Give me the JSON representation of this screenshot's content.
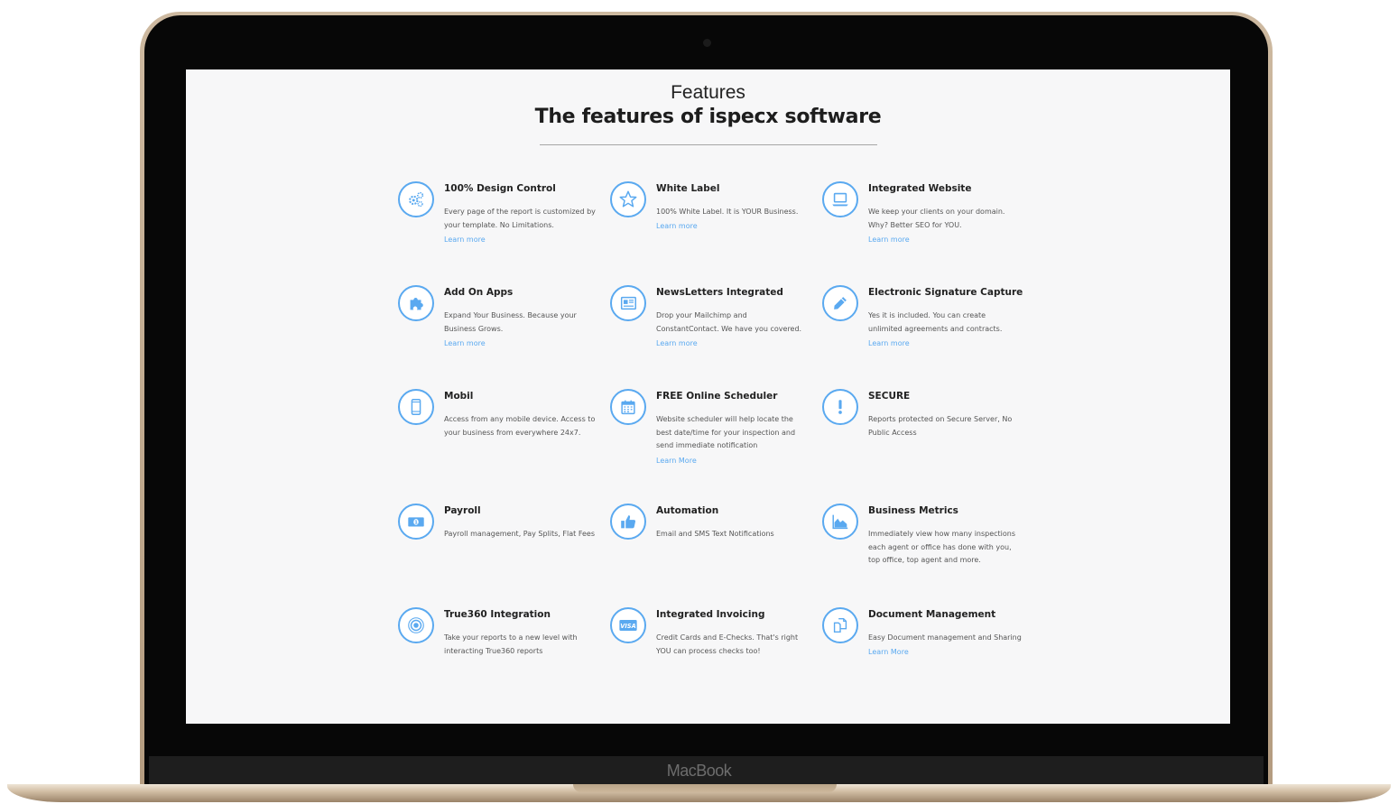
{
  "device": {
    "brand_label": "MacBook"
  },
  "section": {
    "kicker": "Features",
    "headline": "The features of ispecx software"
  },
  "colors": {
    "accent": "#5aa9f0",
    "background": "#f7f7f8",
    "text": "#222222"
  },
  "features": [
    {
      "icon": "gears-icon",
      "title": "100% Design Control",
      "description": "Every page of the report is customized by your template. No Limitations.",
      "link": "Learn more"
    },
    {
      "icon": "star-icon",
      "title": "White Label",
      "description": "100% White Label. It is YOUR Business.",
      "link": "Learn more"
    },
    {
      "icon": "laptop-icon",
      "title": "Integrated Website",
      "description": "We keep your clients on your domain. Why? Better SEO for YOU.",
      "link": "Learn more"
    },
    {
      "icon": "puzzle-icon",
      "title": "Add On Apps",
      "description": "Expand Your Business. Because your Business Grows.",
      "link": "Learn more"
    },
    {
      "icon": "newspaper-icon",
      "title": "NewsLetters Integrated",
      "description": "Drop your Mailchimp and ConstantContact. We have you covered.",
      "link": "Learn more"
    },
    {
      "icon": "pencil-icon",
      "title": "Electronic Signature Capture",
      "description": "Yes it is included. You can create unlimited agreements and contracts.",
      "link": "Learn more"
    },
    {
      "icon": "mobile-icon",
      "title": "Mobil",
      "description": "Access from any mobile device. Access to your business from everywhere 24x7.",
      "link": ""
    },
    {
      "icon": "calendar-icon",
      "title": "FREE Online Scheduler",
      "description": "Website scheduler will help locate the best date/time for your inspection and send immediate notification",
      "link": "Learn More"
    },
    {
      "icon": "exclamation-icon",
      "title": "SECURE",
      "description": "Reports protected on Secure Server, No Public Access",
      "link": ""
    },
    {
      "icon": "money-icon",
      "title": "Payroll",
      "description": "Payroll management, Pay Splits, Flat Fees",
      "link": ""
    },
    {
      "icon": "thumbs-up-icon",
      "title": "Automation",
      "description": "Email and SMS Text Notifications",
      "link": ""
    },
    {
      "icon": "area-chart-icon",
      "title": "Business Metrics",
      "description": "Immediately view how many inspections each agent or office has done with you, top office, top agent and more.",
      "link": ""
    },
    {
      "icon": "target-icon",
      "title": "True360 Integration",
      "description": "Take your reports to a new level with interacting True360 reports",
      "link": ""
    },
    {
      "icon": "visa-card-icon",
      "title": "Integrated Invoicing",
      "description": "Credit Cards and E-Checks. That's right YOU can process checks too!",
      "link": ""
    },
    {
      "icon": "documents-icon",
      "title": "Document Management",
      "description": "Easy Document management and Sharing",
      "link": "Learn More"
    }
  ]
}
